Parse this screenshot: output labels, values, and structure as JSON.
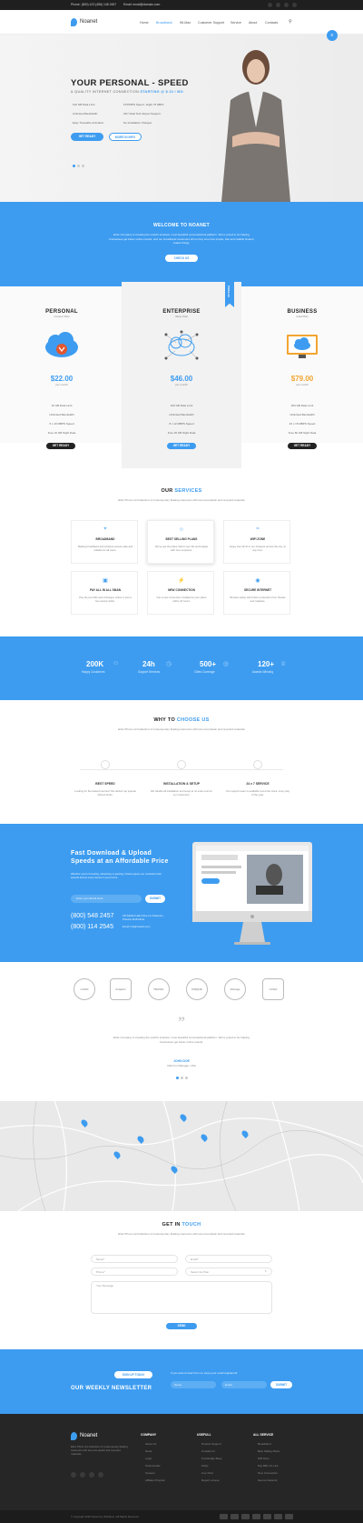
{
  "topbar": {
    "phone": "Phone: (800) 123 (456) 148 2457",
    "email": "Email: email@domain.com"
  },
  "nav": {
    "brand": "Noanet",
    "items": [
      "Home",
      "Broadband",
      "Wi-Max",
      "Customer Support",
      "Service",
      "About",
      "Contacts"
    ]
  },
  "hero": {
    "title": "YOUR PERSONAL - SPEED",
    "subtitle_prefix": "& QUALITY INTERNET CONNECTION",
    "subtitle_price": "STARTING @ $ 22 / MO",
    "features": [
      "100 GB Data Limit",
      "FTP/MPS Speed - Eight 70 MB/S",
      "Unlimited Bandwidth",
      "24/7 Real Tech Expert Support",
      "Easy Traceable Activation",
      "No Installation Charges"
    ],
    "btn_primary": "GET READY",
    "btn_secondary": "MORE IN INFO"
  },
  "welcome": {
    "title": "WELCOME TO NOANET",
    "text": "Elnic Company is creating the world's simplest, most beautiful conversational platform. We're proud to be helping businesses get better online results, and our broadband customers tell us they love how simple, fast and reliable Noanet makes things.",
    "button": "CHECK US"
  },
  "plans": [
    {
      "name": "PERSONAL",
      "desc": "Custom Plan",
      "price": "$22.00",
      "per": "per month",
      "items": [
        "10 GB Data Limit",
        "Unlimited Bandwidth",
        "6 x 10 MBPS Speed",
        "Free 10 GB Night Data"
      ],
      "btn": "GET READY"
    },
    {
      "name": "ENTERPRISE",
      "desc": "Value Plan",
      "price": "$46.00",
      "per": "per month",
      "items": [
        "100 GB Data Limit",
        "Unlimited Bandwidth",
        "8 x 12 MBPS Speed",
        "Free 25 GB Night Data"
      ],
      "btn": "GET READY",
      "badge": "POPULAR"
    },
    {
      "name": "BUSINESS",
      "desc": "Gold Plan",
      "price": "$79.00",
      "per": "per month",
      "items": [
        "200 GB Data Limit",
        "Unlimited Bandwidth",
        "10 x 15 MBPS Speed",
        "Free 50 GB Night Data"
      ],
      "btn": "GET READY"
    }
  ],
  "services": {
    "title_a": "OUR",
    "title_b": "SERVICES",
    "text": "Elnic Photo Ltd Collection of contemporary floating restrooms with low-cost plastic and recycled materials",
    "items": [
      {
        "title": "BROADBAND",
        "text": "Making broadband and wireless access safe and reliable for all users."
      },
      {
        "title": "BEST SELLING PLANS",
        "text": "We've got the plans that fit your life and budget with zero surprises."
      },
      {
        "title": "WIFI ZONE",
        "text": "Enjoy free Wi-Fi in our hotspots across the city, at any time."
      },
      {
        "title": "PAY ALL IN ALL SMAN",
        "text": "Pay all your bills and recharges online in just a few simple clicks."
      },
      {
        "title": "NEW CONNECTION",
        "text": "Get a new connection installed at your place within 24 hours."
      },
      {
        "title": "SECURE INTERNET",
        "text": "Browse safely with built-in protection from threats and malware."
      }
    ]
  },
  "stats": [
    {
      "value": "200K",
      "label": "Happy Customers"
    },
    {
      "value": "24h",
      "label": "Support Services"
    },
    {
      "value": "500+",
      "label": "Cities Coverage"
    },
    {
      "value": "120+",
      "label": "Awards Winning"
    }
  ],
  "why": {
    "title_a": "WHY TO",
    "title_b": "CHOOSE US",
    "text": "Elnic Photo Ltd Collection of contemporary floating restrooms with low-cost plastic and recycled materials",
    "items": [
      {
        "title": "BEST SPEED",
        "text": "Looking for the fastest internet? We deliver top speeds without limits."
      },
      {
        "title": "INSTALLATION & SETUP",
        "text": "We handle all installation and setup at no extra cost for our customers."
      },
      {
        "title": "24 x 7 SERVICE",
        "text": "Our support team is available round the clock, every day of the year."
      }
    ]
  },
  "download": {
    "title": "Fast Download & Upload Speeds at an Affordable Price",
    "text": "Whether you're browsing, streaming or gaming, Noanet gives you consistent fast speeds across every device in your home.",
    "email_placeholder": "Enter your Email Here",
    "submit": "SUBMIT",
    "phone1": "(800) 548 2457",
    "phone2": "(800) 114 2545",
    "address": "Old Madrid Hall 2 Rue Ivo Redecine, Pretoria 1118 Africa",
    "email": "Email: info@noanet.com"
  },
  "partners": [
    "LOGO",
    "Graphic",
    "TRAVEL",
    "UNIQUE",
    "Vintage",
    "LOGO"
  ],
  "testimonial": {
    "text": "Elnic Company is creating the world's simplest, most beautiful conversational platform. We're proud to be helping businesses get better online results.",
    "name": "JOHN DOE",
    "role": "CEO Inc Manager, USA"
  },
  "contact": {
    "title_a": "GET IN",
    "title_b": "TOUCH",
    "text": "Elnic Photo Ltd Collection of contemporary floating restrooms with low-cost plastic and recycled materials",
    "name": "Name*",
    "email": "Email*",
    "phone": "Phone*",
    "plan": "Select the Plan",
    "message": "Your Message",
    "send": "SEND"
  },
  "newsletter": {
    "btn": "SIGN UP TODAY",
    "title": "OUR WEEKLY NEWSLETTER",
    "text": "If you want to hear from us, keep your email registered!",
    "name": "Name",
    "email": "Email",
    "submit": "SUBMIT"
  },
  "footer": {
    "brand": "Noanet",
    "about": "Elnic Photo Ltd Collection of contemporary floating restrooms with low-cost plastic and recycled materials.",
    "cols": [
      {
        "h": "COMPANY",
        "items": [
          "About Us",
          "News",
          "Login",
          "Testimonials",
          "Careers",
          "Affiliate Program"
        ]
      },
      {
        "h": "USEFULL",
        "items": [
          "Product Support",
          "Contact Us",
          "Knowledge Base",
          "FAQs",
          "Live Chat",
          "Report a Issue"
        ]
      },
      {
        "h": "ALL SERVICE",
        "items": [
          "Broadband",
          "Best Selling Plans",
          "Wifi Zone",
          "Pay Bills On Line",
          "New Connection",
          "Secure Network"
        ]
      }
    ],
    "copyright": "© Copyright 2016 Noanet by Webfame | All Rights Reserved"
  }
}
